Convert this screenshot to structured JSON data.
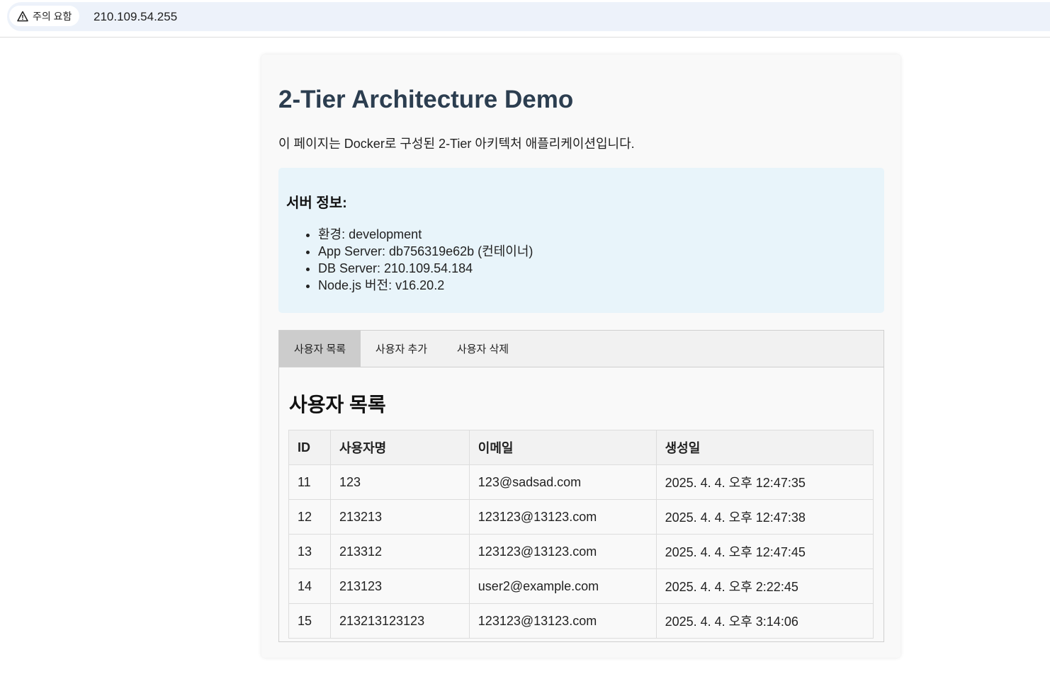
{
  "browser": {
    "security_label": "주의 요함",
    "url": "210.109.54.255"
  },
  "page": {
    "title": "2-Tier Architecture Demo",
    "intro": "이 페이지는 Docker로 구성된 2-Tier 아키텍처 애플리케이션입니다."
  },
  "server_info": {
    "heading": "서버 정보:",
    "items": [
      "환경: development",
      "App Server: db756319e62b (컨테이너)",
      "DB Server: 210.109.54.184",
      "Node.js 버전: v16.20.2"
    ]
  },
  "tabs": [
    {
      "label": "사용자 목록",
      "active": true
    },
    {
      "label": "사용자 추가",
      "active": false
    },
    {
      "label": "사용자 삭제",
      "active": false
    }
  ],
  "user_list": {
    "title": "사용자 목록",
    "columns": [
      "ID",
      "사용자명",
      "이메일",
      "생성일"
    ],
    "rows": [
      [
        "11",
        "123",
        "123@sadsad.com",
        "2025. 4. 4. 오후 12:47:35"
      ],
      [
        "12",
        "213213",
        "123123@13123.com",
        "2025. 4. 4. 오후 12:47:38"
      ],
      [
        "13",
        "213312",
        "123123@13123.com",
        "2025. 4. 4. 오후 12:47:45"
      ],
      [
        "14",
        "213123",
        "user2@example.com",
        "2025. 4. 4. 오후 2:22:45"
      ],
      [
        "15",
        "213213123123",
        "123123@13123.com",
        "2025. 4. 4. 오후 3:14:06"
      ]
    ]
  },
  "colors": {
    "title": "#2c3e50",
    "info_box": "#e8f4fa",
    "active_tab": "#cccccc"
  }
}
